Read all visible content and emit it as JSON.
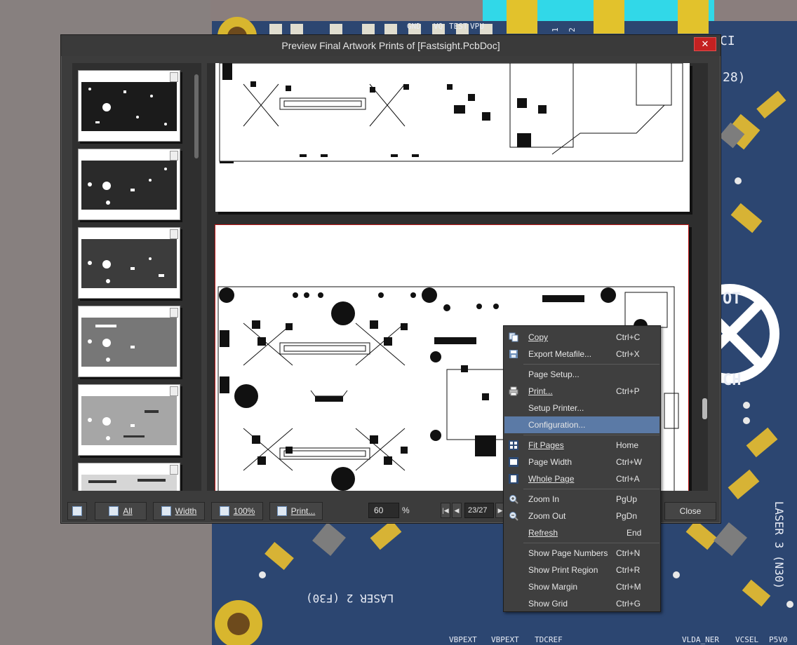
{
  "window": {
    "title": "Preview Final Artwork Prints of [Fastsight.PcbDoc]",
    "close_glyph": "✕"
  },
  "pcb": {
    "silk_top": [
      "GND",
      "VQ",
      "TEST",
      "VPU"
    ],
    "silk_numbers": [
      "1",
      "2"
    ],
    "silk_misc": [
      "CI",
      "28)"
    ],
    "laser2": "LASER 2 (F30)",
    "laser3": "LASER 3 (N30)",
    "ot_text": "OT",
    "ch_text": "CH",
    "bottom_labels": [
      "VBPEXT",
      "VBPEXT",
      "TDCREF",
      "VLDA_NER",
      "VCSEL",
      "P5V0"
    ]
  },
  "toolbar": {
    "all": "All",
    "width": "Width",
    "hundred": "100%",
    "print": "Print...",
    "zoom_value": "60",
    "zoom_unit": "%",
    "page_indicator": "23/27",
    "close": "Close"
  },
  "menu": {
    "items": [
      {
        "label": "Copy",
        "shortcut": "Ctrl+C",
        "icon": "copy-icon"
      },
      {
        "label": "Export Metafile...",
        "shortcut": "Ctrl+X",
        "icon": "save-icon"
      },
      {
        "label": "Page Setup...",
        "shortcut": "",
        "icon": ""
      },
      {
        "label": "Print...",
        "shortcut": "Ctrl+P",
        "icon": "printer-icon"
      },
      {
        "label": "Setup Printer...",
        "shortcut": "",
        "icon": ""
      },
      {
        "label": "Configuration...",
        "shortcut": "",
        "icon": ""
      },
      {
        "label": "Fit Pages",
        "shortcut": "Home",
        "icon": "fit-pages-icon"
      },
      {
        "label": "Page Width",
        "shortcut": "Ctrl+W",
        "icon": "page-width-icon"
      },
      {
        "label": "Whole Page",
        "shortcut": "Ctrl+A",
        "icon": "whole-page-icon"
      },
      {
        "label": "Zoom In",
        "shortcut": "PgUp",
        "icon": "zoom-in-icon"
      },
      {
        "label": "Zoom Out",
        "shortcut": "PgDn",
        "icon": "zoom-out-icon"
      },
      {
        "label": "Refresh",
        "shortcut": "End",
        "icon": ""
      },
      {
        "label": "Show Page Numbers",
        "shortcut": "Ctrl+N",
        "icon": ""
      },
      {
        "label": "Show Print Region",
        "shortcut": "Ctrl+R",
        "icon": ""
      },
      {
        "label": "Show Margin",
        "shortcut": "Ctrl+M",
        "icon": ""
      },
      {
        "label": "Show Grid",
        "shortcut": "Ctrl+G",
        "icon": ""
      }
    ]
  },
  "colors": {
    "pcb_blue": "#2c4671",
    "menu_highlight": "#5b7aa6",
    "title_close": "#c42121",
    "gold": "#d8b62e"
  }
}
